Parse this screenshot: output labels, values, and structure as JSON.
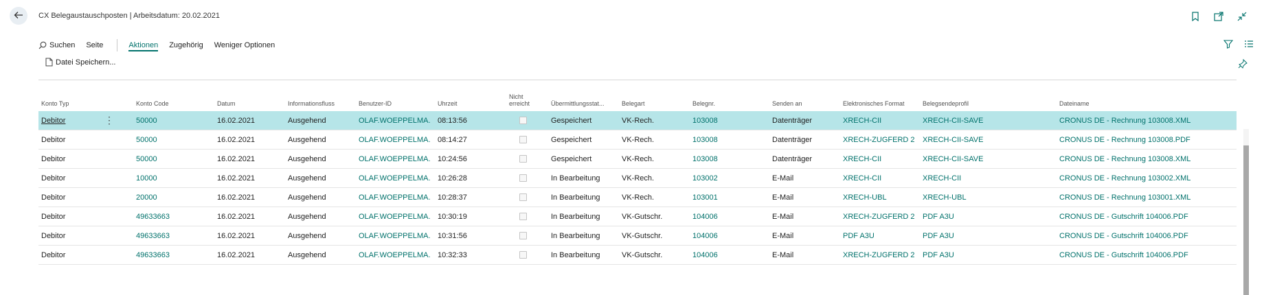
{
  "header": {
    "title": "CX Belegaustauschposten | Arbeitsdatum: 20.02.2021"
  },
  "actions": {
    "search": "Suchen",
    "page": "Seite",
    "actions": "Aktionen",
    "related": "Zugehörig",
    "fewer": "Weniger Optionen",
    "save_file": "Datei Speichern..."
  },
  "columns": {
    "konto_typ": "Konto Typ",
    "konto_code": "Konto Code",
    "datum": "Datum",
    "informationsfluss": "Informationsfluss",
    "benutzer_id": "Benutzer-ID",
    "uhrzeit": "Uhrzeit",
    "nicht_erreicht_1": "Nicht",
    "nicht_erreicht_2": "erreicht",
    "uebermittlungsstatus": "Übermittlungsstat...",
    "belegart": "Belegart",
    "belegnr": "Belegnr.",
    "senden_an": "Senden an",
    "elektronisches_format": "Elektronisches Format",
    "belegsendeprofil": "Belegsendeprofil",
    "dateiname": "Dateiname"
  },
  "rows": [
    {
      "typ": "Debitor",
      "code": "50000",
      "datum": "16.02.2021",
      "fluss": "Ausgehend",
      "user": "OLAF.WOEPPELMA...",
      "zeit": "08:13:56",
      "status": "Gespeichert",
      "art": "VK-Rech.",
      "nr": "103008",
      "senden": "Datenträger",
      "format": "XRECH-CII",
      "profil": "XRECH-CII-SAVE",
      "datei": "CRONUS DE - Rechnung 103008.XML"
    },
    {
      "typ": "Debitor",
      "code": "50000",
      "datum": "16.02.2021",
      "fluss": "Ausgehend",
      "user": "OLAF.WOEPPELMA...",
      "zeit": "08:14:27",
      "status": "Gespeichert",
      "art": "VK-Rech.",
      "nr": "103008",
      "senden": "Datenträger",
      "format": "XRECH-ZUGFERD 2",
      "profil": "XRECH-CII-SAVE",
      "datei": "CRONUS DE - Rechnung 103008.PDF"
    },
    {
      "typ": "Debitor",
      "code": "50000",
      "datum": "16.02.2021",
      "fluss": "Ausgehend",
      "user": "OLAF.WOEPPELMA...",
      "zeit": "10:24:56",
      "status": "Gespeichert",
      "art": "VK-Rech.",
      "nr": "103008",
      "senden": "Datenträger",
      "format": "XRECH-CII",
      "profil": "XRECH-CII-SAVE",
      "datei": "CRONUS DE - Rechnung 103008.XML"
    },
    {
      "typ": "Debitor",
      "code": "10000",
      "datum": "16.02.2021",
      "fluss": "Ausgehend",
      "user": "OLAF.WOEPPELMA...",
      "zeit": "10:26:28",
      "status": "In Bearbeitung",
      "art": "VK-Rech.",
      "nr": "103002",
      "senden": "E-Mail",
      "format": "XRECH-CII",
      "profil": "XRECH-CII",
      "datei": "CRONUS DE - Rechnung 103002.XML"
    },
    {
      "typ": "Debitor",
      "code": "20000",
      "datum": "16.02.2021",
      "fluss": "Ausgehend",
      "user": "OLAF.WOEPPELMA...",
      "zeit": "10:28:37",
      "status": "In Bearbeitung",
      "art": "VK-Rech.",
      "nr": "103001",
      "senden": "E-Mail",
      "format": "XRECH-UBL",
      "profil": "XRECH-UBL",
      "datei": "CRONUS DE - Rechnung 103001.XML"
    },
    {
      "typ": "Debitor",
      "code": "49633663",
      "datum": "16.02.2021",
      "fluss": "Ausgehend",
      "user": "OLAF.WOEPPELMA...",
      "zeit": "10:30:19",
      "status": "In Bearbeitung",
      "art": "VK-Gutschr.",
      "nr": "104006",
      "senden": "E-Mail",
      "format": "XRECH-ZUGFERD 2",
      "profil": "PDF A3U",
      "datei": "CRONUS DE - Gutschrift 104006.PDF"
    },
    {
      "typ": "Debitor",
      "code": "49633663",
      "datum": "16.02.2021",
      "fluss": "Ausgehend",
      "user": "OLAF.WOEPPELMA...",
      "zeit": "10:31:56",
      "status": "In Bearbeitung",
      "art": "VK-Gutschr.",
      "nr": "104006",
      "senden": "E-Mail",
      "format": "PDF A3U",
      "profil": "PDF A3U",
      "datei": "CRONUS DE - Gutschrift 104006.PDF"
    },
    {
      "typ": "Debitor",
      "code": "49633663",
      "datum": "16.02.2021",
      "fluss": "Ausgehend",
      "user": "OLAF.WOEPPELMA...",
      "zeit": "10:32:33",
      "status": "In Bearbeitung",
      "art": "VK-Gutschr.",
      "nr": "104006",
      "senden": "E-Mail",
      "format": "XRECH-ZUGFERD 2",
      "profil": "PDF A3U",
      "datei": "CRONUS DE - Gutschrift 104006.PDF"
    }
  ]
}
